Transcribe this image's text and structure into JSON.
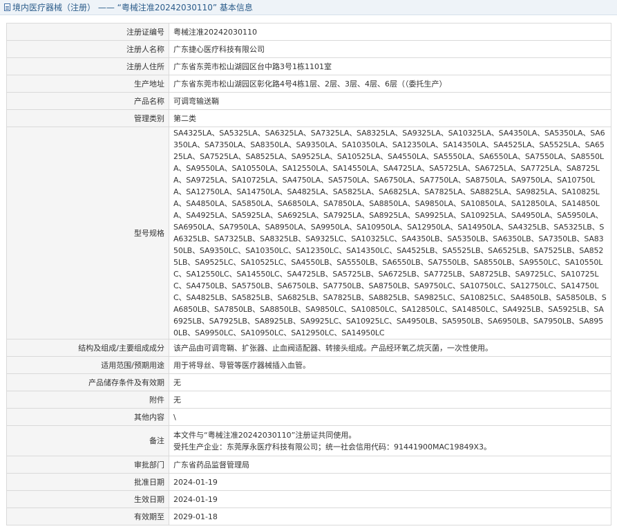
{
  "header": {
    "title": "境内医疗器械（注册） —— “粤械注准20242030110” 基本信息"
  },
  "fields": [
    {
      "label": "注册证编号",
      "value": "粤械注准20242030110"
    },
    {
      "label": "注册人名称",
      "value": "广东捷心医疗科技有限公司"
    },
    {
      "label": "注册人住所",
      "value": "广东省东莞市松山湖园区台中路3号1栋1101室"
    },
    {
      "label": "生产地址",
      "value": "广东省东莞市松山湖园区彰化路4号4栋1层、2层、3层、4层、6层（（委托生产）"
    },
    {
      "label": "产品名称",
      "value": "可调弯输送鞘"
    },
    {
      "label": "管理类别",
      "value": "第二类"
    },
    {
      "label": "型号规格",
      "value": "SA4325LA、SA5325LA、SA6325LA、SA7325LA、SA8325LA、SA9325LA、SA10325LA、SA4350LA、SA5350LA、SA6350LA、SA7350LA、SA8350LA、SA9350LA、SA10350LA、SA12350LA、SA14350LA、SA4525LA、SA5525LA、SA6525LA、SA7525LA、SA8525LA、SA9525LA、SA10525LA、SA4550LA、SA5550LA、SA6550LA、SA7550LA、SA8550LA、SA9550LA、SA10550LA、SA12550LA、SA14550LA、SA4725LA、SA5725LA、SA6725LA、SA7725LA、SA8725LA、SA9725LA、SA10725LA、SA4750LA、SA5750LA、SA6750LA、SA7750LA、SA8750LA、SA9750LA、SA10750LA、SA12750LA、SA14750LA、SA4825LA、SA5825LA、SA6825LA、SA7825LA、SA8825LA、SA9825LA、SA10825LA、SA4850LA、SA5850LA、SA6850LA、SA7850LA、SA8850LA、SA9850LA、SA10850LA、SA12850LA、SA14850LA、SA4925LA、SA5925LA、SA6925LA、SA7925LA、SA8925LA、SA9925LA、SA10925LA、SA4950LA、SA5950LA、SA6950LA、SA7950LA、SA8950LA、SA9950LA、SA10950LA、SA12950LA、SA14950LA、SA4325LB、SA5325LB、SA6325LB、SA7325LB、SA8325LB、SA9325LC、SA10325LC、SA4350LB、SA5350LB、SA6350LB、SA7350LB、SA8350LB、SA9350LC、SA10350LC、SA12350LC、SA14350LC、SA4525LB、SA5525LB、SA6525LB、SA7525LB、SA8525LB、SA9525LC、SA10525LC、SA4550LB、SA5550LB、SA6550LB、SA7550LB、SA8550LB、SA9550LC、SA10550LC、SA12550LC、SA14550LC、SA4725LB、SA5725LB、SA6725LB、SA7725LB、SA8725LB、SA9725LC、SA10725LC、SA4750LB、SA5750LB、SA6750LB、SA7750LB、SA8750LB、SA9750LC、SA10750LC、SA12750LC、SA14750LC、SA4825LB、SA5825LB、SA6825LB、SA7825LB、SA8825LB、SA9825LC、SA10825LC、SA4850LB、SA5850LB、SA6850LB、SA7850LB、SA8850LB、SA9850LC、SA10850LC、SA12850LC、SA14850LC、SA4925LB、SA5925LB、SA6925LB、SA7925LB、SA8925LB、SA9925LC、SA10925LC、SA4950LB、SA5950LB、SA6950LB、SA7950LB、SA8950LB、SA9950LC、SA10950LC、SA12950LC、SA14950LC"
    },
    {
      "label": "结构及组成/主要组成成分",
      "value": "该产品由可调弯鞘、扩张器、止血阀适配器、转接头组成。产品经环氧乙烷灭菌，一次性使用。"
    },
    {
      "label": "适用范围/预期用途",
      "value": "用于将导丝、导管等医疗器械插入血管。"
    },
    {
      "label": "产品储存条件及有效期",
      "value": "无"
    },
    {
      "label": "附件",
      "value": "无"
    },
    {
      "label": "其他内容",
      "value": "\\"
    },
    {
      "label": "备注",
      "line1": "本文件与“粤械注准20242030110”注册证共同使用。",
      "line2": "受托生产企业：东莞厚永医疗科技有限公司；统一社会信用代码：91441900MAC19849X3。"
    },
    {
      "label": "审批部门",
      "value": "广东省药品监督管理局"
    },
    {
      "label": "批准日期",
      "value": "2024-01-19"
    },
    {
      "label": "生效日期",
      "value": "2024-01-19"
    },
    {
      "label": "有效期至",
      "value": "2029-01-18"
    }
  ]
}
